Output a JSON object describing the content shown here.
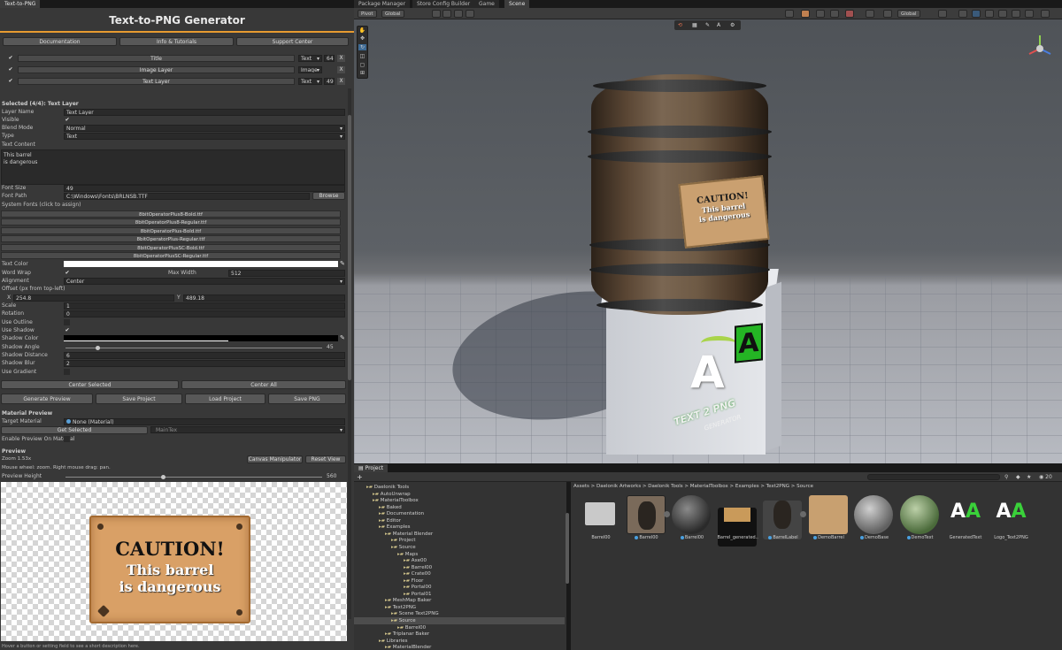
{
  "left_panel": {
    "tab": "Text-to-PNG",
    "title": "Text-to-PNG Generator",
    "top_buttons": [
      "Documentation",
      "Info & Tutorials",
      "Support Center"
    ],
    "layers": [
      {
        "name": "Title",
        "type": "Text",
        "size": "64",
        "remove": "X"
      },
      {
        "name": "Image Layer",
        "type": "Image",
        "size": "",
        "remove": "X"
      },
      {
        "name": "Text Layer",
        "type": "Text",
        "size": "49",
        "remove": "X"
      }
    ],
    "selected_header": "Selected (4/4): Text Layer",
    "props": {
      "layer_name_label": "Layer Name",
      "layer_name": "Text Layer",
      "visible_label": "Visible",
      "visible": "✔",
      "blend_label": "Blend Mode",
      "blend": "Normal",
      "type_label": "Type",
      "type": "Text",
      "text_content_label": "Text Content",
      "text_line1": "This barrel",
      "text_line2": "is dangerous",
      "font_size_label": "Font Size",
      "font_size": "49",
      "font_path_label": "Font Path",
      "font_path": "C:\\Windows\\Fonts\\BRLNSB.TTF",
      "browse": "Browse",
      "system_fonts_label": "System Fonts (click to assign)",
      "fonts": [
        "8bitOperatorPlus8-Bold.ttf",
        "8bitOperatorPlus8-Regular.ttf",
        "8bitOperatorPlus-Bold.ttf",
        "8bitOperatorPlus-Regular.ttf",
        "8bitOperatorPlusSC-Bold.ttf",
        "8bitOperatorPlusSC-Regular.ttf"
      ],
      "text_color_label": "Text Color",
      "word_wrap_label": "Word Wrap",
      "word_wrap": "✔",
      "max_width_label": "Max Width",
      "max_width": "512",
      "alignment_label": "Alignment",
      "alignment": "Center",
      "offset_label": "Offset (px from top-left)",
      "x_label": "X",
      "x": "254.8",
      "y_label": "Y",
      "y": "489.18",
      "scale_label": "Scale",
      "scale": "1",
      "rotation_label": "Rotation",
      "rotation": "0",
      "use_outline_label": "Use Outline",
      "use_shadow_label": "Use Shadow",
      "use_shadow": "✔",
      "shadow_color_label": "Shadow Color",
      "shadow_angle_label": "Shadow Angle",
      "shadow_angle": "45",
      "shadow_angle_fraction": 0.125,
      "shadow_distance_label": "Shadow Distance",
      "shadow_distance": "6",
      "shadow_blur_label": "Shadow Blur",
      "shadow_blur": "2",
      "use_gradient_label": "Use Gradient"
    },
    "center_selected": "Center Selected",
    "center_all": "Center All",
    "actions": [
      "Generate Preview",
      "Save Project",
      "Load Project",
      "Save PNG"
    ],
    "material_preview": {
      "header": "Material Preview",
      "target_label": "Target Material",
      "target_value": "None (Material)",
      "get_selected": "Get Selected",
      "property": "_MainTex",
      "enable_label": "Enable Preview On Material"
    },
    "preview": {
      "header": "Preview",
      "zoom": "Zoom 1.53x",
      "canvas_manipulator": "Canvas Manipulator",
      "reset_view": "Reset View",
      "hint": "Mouse wheel: zoom. Right mouse drag: pan.",
      "height_label": "Preview Height",
      "height": "560",
      "height_fraction": 0.38,
      "sign_line1": "CAUTION!",
      "sign_line2": "This barrel",
      "sign_line3": "is dangerous"
    },
    "footer": "Hover a button or setting field to see a short description here."
  },
  "scene": {
    "tabs": [
      "Package Manager",
      "Store Config Builder",
      "Game",
      "Scene"
    ],
    "pivot": "Pivot",
    "global": "Global",
    "global2": "Global",
    "overlay_icons": [
      "A"
    ],
    "plate_line1": "CAUTION!",
    "plate_line2": "This barrel",
    "plate_line3": "is dangerous",
    "logo_a1": "A",
    "logo_a2": "A",
    "logo_caption": "TEXT 2 PNG",
    "logo_caption2": "GENERATOR"
  },
  "project": {
    "tab": "Project",
    "add": "+",
    "count": "20",
    "tree": [
      {
        "label": "Daelonik Tools",
        "indent": 0
      },
      {
        "label": "AutoUnwrap",
        "indent": 1
      },
      {
        "label": "MaterialToolbox",
        "indent": 1
      },
      {
        "label": "Baked",
        "indent": 2
      },
      {
        "label": "Documentation",
        "indent": 2
      },
      {
        "label": "Editor",
        "indent": 2
      },
      {
        "label": "Examples",
        "indent": 2
      },
      {
        "label": "Material Blender",
        "indent": 3
      },
      {
        "label": "Project",
        "indent": 4
      },
      {
        "label": "Source",
        "indent": 4
      },
      {
        "label": "Maps",
        "indent": 5
      },
      {
        "label": "Axe00",
        "indent": 6
      },
      {
        "label": "Barrel00",
        "indent": 6
      },
      {
        "label": "Crate00",
        "indent": 6
      },
      {
        "label": "Floor",
        "indent": 6
      },
      {
        "label": "Portal00",
        "indent": 6
      },
      {
        "label": "Portal01",
        "indent": 6
      },
      {
        "label": "MeshMap Baker",
        "indent": 3
      },
      {
        "label": "Text2PNG",
        "indent": 3
      },
      {
        "label": "Scene Text2PNG",
        "indent": 4
      },
      {
        "label": "Source",
        "indent": 4
      },
      {
        "label": "Barrel00",
        "indent": 5
      },
      {
        "label": "Triplanar Baker",
        "indent": 3
      },
      {
        "label": "Libraries",
        "indent": 2
      },
      {
        "label": "MaterialBlender",
        "indent": 3
      }
    ],
    "breadcrumb": "Assets > Daelonik Artworks > Daelonik Tools > MaterialToolbox > Examples > Text2PNG > Source",
    "assets": [
      {
        "label": "Barrel00",
        "kind": "folder"
      },
      {
        "label": "Barrel00",
        "kind": "mesh"
      },
      {
        "label": "Barrel00",
        "kind": "sphere-dark"
      },
      {
        "label": "Barrel_generated...",
        "kind": "sign"
      },
      {
        "label": "BarrelLabel",
        "kind": "mesh-label"
      },
      {
        "label": "DemoBarrel",
        "kind": "plate"
      },
      {
        "label": "DemoBase",
        "kind": "sphere-grey"
      },
      {
        "label": "DemoText",
        "kind": "sphere-green"
      },
      {
        "label": "GeneratedText",
        "kind": "logo-small"
      },
      {
        "label": "Logo_Text2PNG",
        "kind": "logo"
      }
    ]
  }
}
